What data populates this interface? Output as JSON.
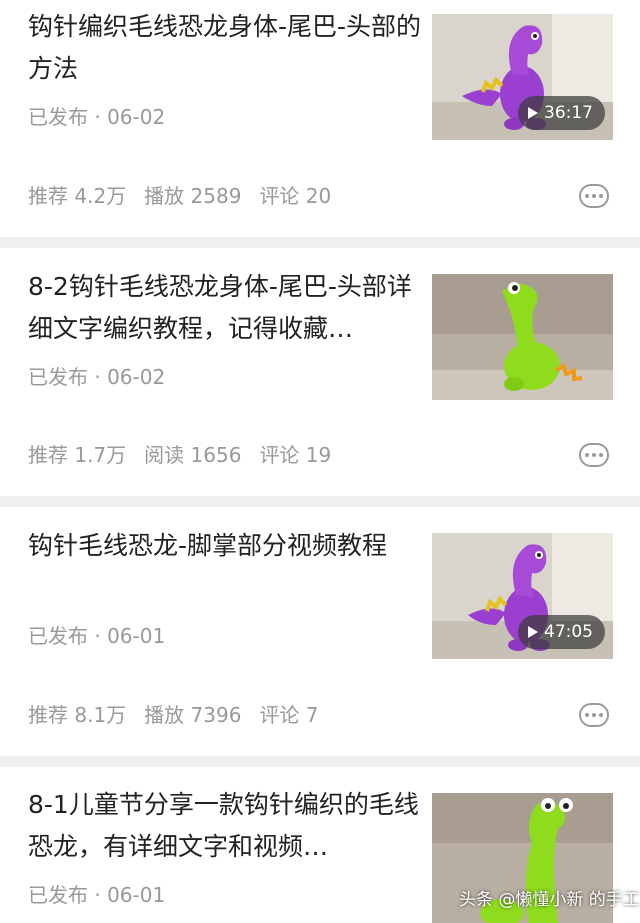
{
  "articles": [
    {
      "title": "钩针编织毛线恐龙身体-尾巴-头部的方法",
      "status": "已发布 · 06-02",
      "stats": {
        "recommend": "推荐 4.2万",
        "views": "播放 2589",
        "comments": "评论 20"
      },
      "duration": "36:17",
      "thumb_color": "purple"
    },
    {
      "title": "8-2钩针毛线恐龙身体-尾巴-头部详细文字编织教程，记得收藏…",
      "status": "已发布 · 06-02",
      "stats": {
        "recommend": "推荐 1.7万",
        "views": "阅读 1656",
        "comments": "评论 19"
      },
      "duration": "",
      "thumb_color": "green"
    },
    {
      "title": "钩针毛线恐龙-脚掌部分视频教程",
      "status": "已发布 · 06-01",
      "stats": {
        "recommend": "推荐 8.1万",
        "views": "播放 7396",
        "comments": "评论 7"
      },
      "duration": "47:05",
      "thumb_color": "purple"
    },
    {
      "title": "8-1儿童节分享一款钩针编织的毛线恐龙，有详细文字和视频…",
      "status": "已发布 · 06-01",
      "stats": {
        "recommend": "",
        "views": "",
        "comments": ""
      },
      "duration": "",
      "thumb_color": "green"
    }
  ],
  "watermark": "头条 @懒懂小新 的手工",
  "colors": {
    "purple": "#9b3fd0",
    "green": "#8fdc1e",
    "text": "#222222",
    "meta": "#999999"
  }
}
